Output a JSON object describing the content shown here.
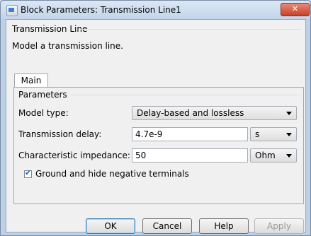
{
  "window": {
    "title": "Block Parameters: Transmission Line1",
    "close_glyph": "✕"
  },
  "block": {
    "name": "Transmission Line",
    "description": "Model a transmission line."
  },
  "tabs": [
    {
      "label": "Main",
      "selected": true
    }
  ],
  "parameters": {
    "group_title": "Parameters",
    "model_type": {
      "label": "Model type:",
      "value": "Delay-based and lossless"
    },
    "transmission_delay": {
      "label": "Transmission delay:",
      "value": "4.7e-9",
      "unit": "s"
    },
    "characteristic_impedance": {
      "label": "Characteristic impedance:",
      "value": "50",
      "unit": "Ohm"
    },
    "ground_checkbox": {
      "label": "Ground and hide negative terminals",
      "checked": true
    }
  },
  "buttons": {
    "ok": "OK",
    "cancel": "Cancel",
    "help": "Help",
    "apply": "Apply"
  },
  "colors": {
    "titlebar": "#c3d5ea",
    "close_button": "#c7402a",
    "client_bg": "#f0f0f0"
  }
}
